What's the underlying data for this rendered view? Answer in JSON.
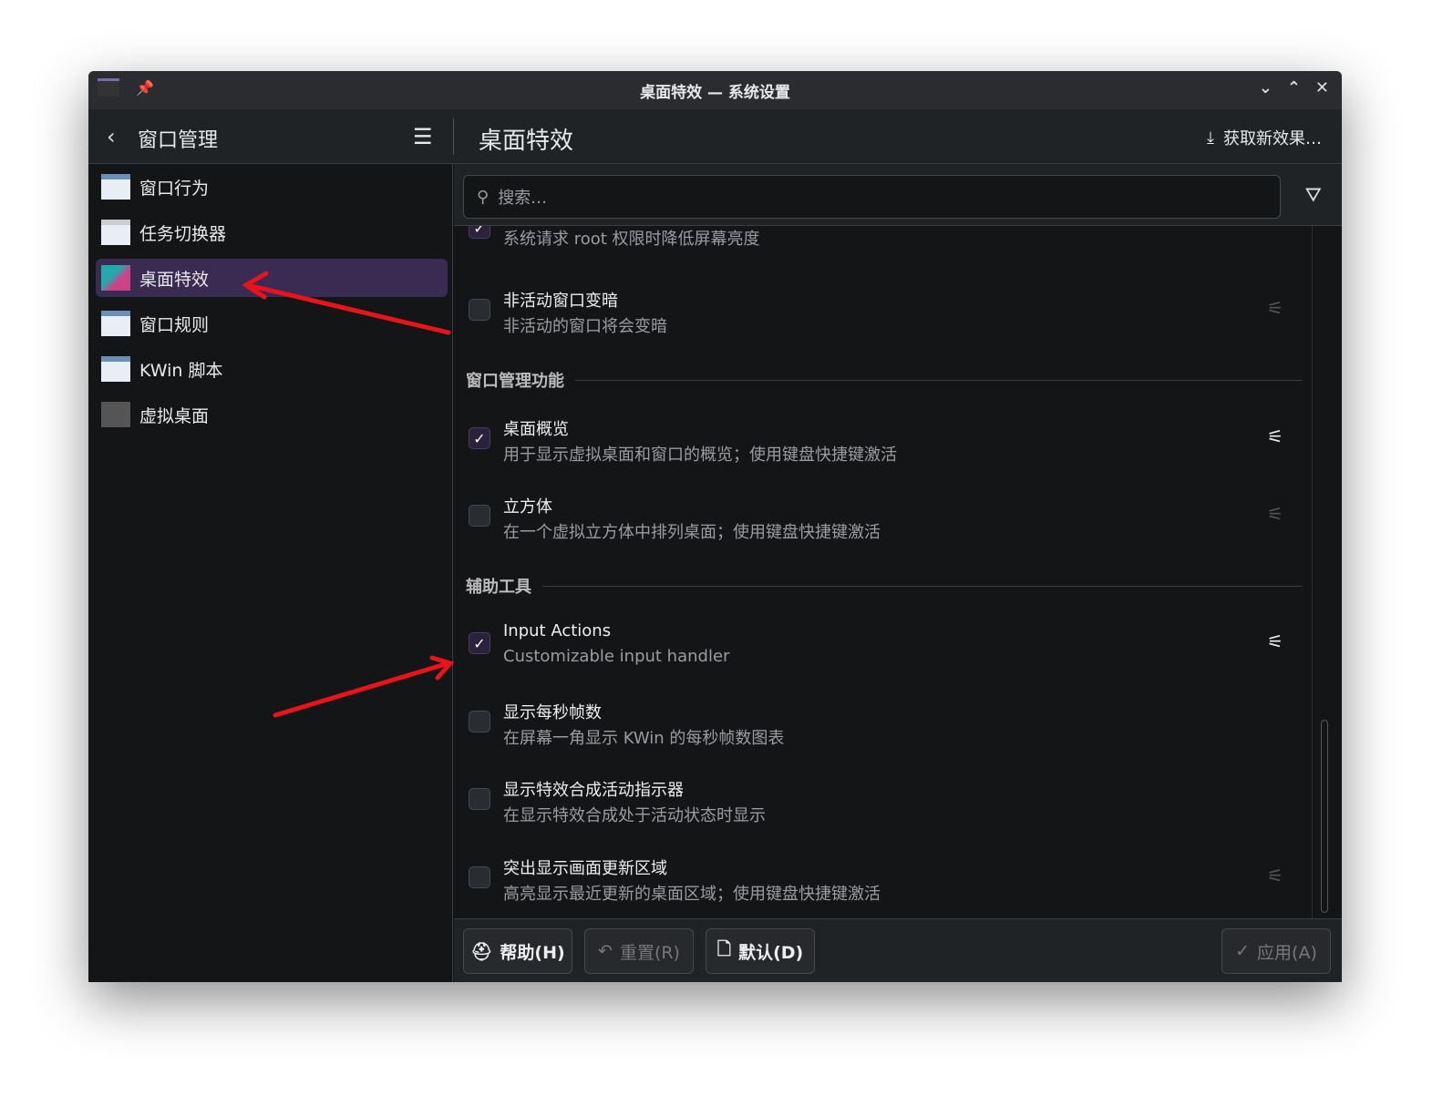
{
  "window": {
    "title": "桌面特效 — 系统设置",
    "controls": {
      "minimize": "⌄",
      "maximize": "⌃",
      "close": "✕"
    }
  },
  "header": {
    "back_icon": "‹",
    "sidebar_title": "窗口管理",
    "menu_icon": "☰",
    "page_title": "桌面特效",
    "get_new": "获取新效果…"
  },
  "sidebar": {
    "items": [
      {
        "label": "窗口行为",
        "icon": "window-icon"
      },
      {
        "label": "任务切换器",
        "icon": "task-switcher-icon"
      },
      {
        "label": "桌面特效",
        "icon": "desktop-effects-icon",
        "selected": true
      },
      {
        "label": "窗口规则",
        "icon": "window-icon"
      },
      {
        "label": "KWin 脚本",
        "icon": "window-icon"
      },
      {
        "label": "虚拟桌面",
        "icon": "virtual-desktop-icon"
      }
    ]
  },
  "search": {
    "placeholder": "搜索…"
  },
  "effects": {
    "row0": {
      "desc": "系统请求 root 权限时降低屏幕亮度",
      "checked": true
    },
    "row1": {
      "title": "非活动窗口变暗",
      "desc": "非活动的窗口将会变暗",
      "checked": false
    },
    "section1": "窗口管理功能",
    "row2": {
      "title": "桌面概览",
      "desc": "用于显示虚拟桌面和窗口的概览；使用键盘快捷键激活",
      "checked": true
    },
    "row3": {
      "title": "立方体",
      "desc": "在一个虚拟立方体中排列桌面；使用键盘快捷键激活",
      "checked": false
    },
    "section2": "辅助工具",
    "row4": {
      "title": "Input Actions",
      "desc": "Customizable input handler",
      "checked": true
    },
    "row5": {
      "title": "显示每秒帧数",
      "desc": "在屏幕一角显示 KWin 的每秒帧数图表",
      "checked": false
    },
    "row6": {
      "title": "显示特效合成活动指示器",
      "desc": "在显示特效合成处于活动状态时显示",
      "checked": false
    },
    "row7": {
      "title": "突出显示画面更新区域",
      "desc": "高亮显示最近更新的桌面区域；使用键盘快捷键激活",
      "checked": false
    }
  },
  "footer": {
    "help": "帮助(H)",
    "reset": "重置(R)",
    "defaults": "默认(D)",
    "apply": "应用(A)"
  },
  "annotation_color": "#e8141a"
}
